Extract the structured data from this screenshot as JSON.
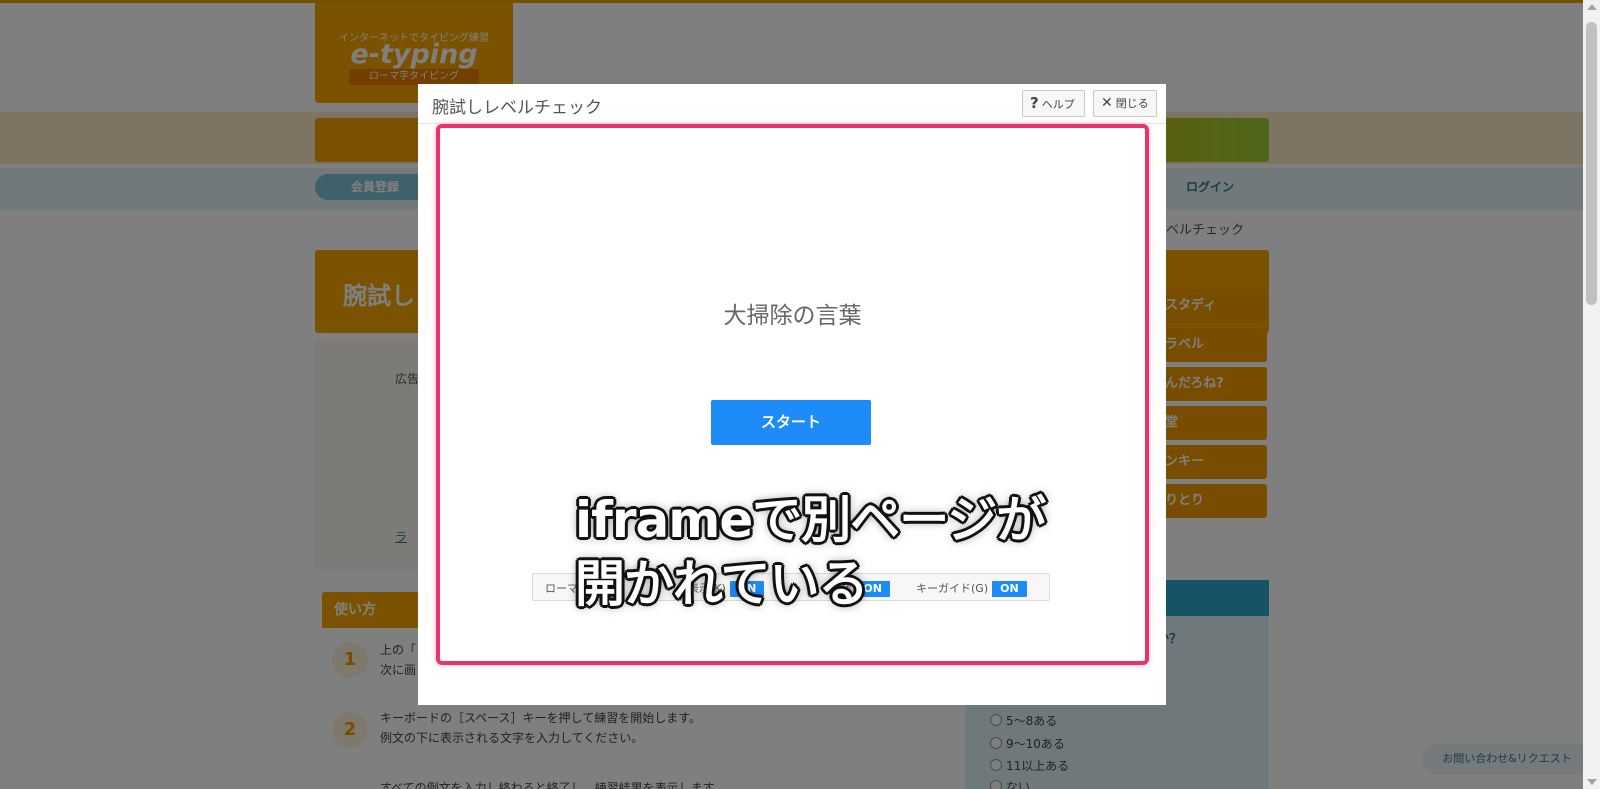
{
  "site": {
    "logo_tagline": "インターネットでタイピング練習",
    "logo_name": "e-typing",
    "logo_sub": "ローマ字タイピング",
    "nav": {
      "register": "会員登録",
      "login": "ログイン"
    },
    "breadcrumb": "しレベルチェック",
    "page_title": "腕試し",
    "ad_label": "広告",
    "link_text": "ラ",
    "side_menu": [
      "スタディ",
      "ラベル",
      "んだろね?",
      "堂",
      "ンキー",
      "りとり"
    ],
    "usage": {
      "heading": "使い方",
      "steps": [
        {
          "num": "1",
          "lines": [
            "上の「",
            "次に画"
          ]
        },
        {
          "num": "2",
          "lines": [
            "キーボードの［スペース］キーを押して練習を開始します。",
            "例文の下に表示される文字を入力してください。"
          ]
        },
        {
          "num": "",
          "lines": [
            "すべての例文を入力し終わると終了し、練習結果を表示します。"
          ]
        }
      ]
    },
    "survey": {
      "question": "すか？",
      "options": [
        "5～8ある",
        "9～10ある",
        "11以上ある",
        "ない"
      ]
    },
    "contact": "お問い合わせ&リクエスト"
  },
  "modal": {
    "title": "腕試しレベルチェック",
    "help_label": "ヘルプ",
    "help_icon": "question-icon",
    "close_label": "閉じる",
    "close_icon": "close-icon",
    "frame": {
      "word_title": "大掃除の言葉",
      "start_label": "スタート",
      "options": [
        {
          "label": "ローマ",
          "state": ""
        },
        {
          "label": "表示(K)",
          "state": "ON"
        },
        {
          "label": "ビープ音",
          "state": "ON"
        },
        {
          "label": "キーガイド(G)",
          "state": "ON"
        }
      ]
    }
  },
  "annotation": {
    "line1": "iframeで別ページが",
    "line2": "開かれている"
  },
  "colors": {
    "accent_orange": "#f7a600",
    "primary_blue": "#1d8cf8",
    "highlight_pink": "#e8336d"
  }
}
